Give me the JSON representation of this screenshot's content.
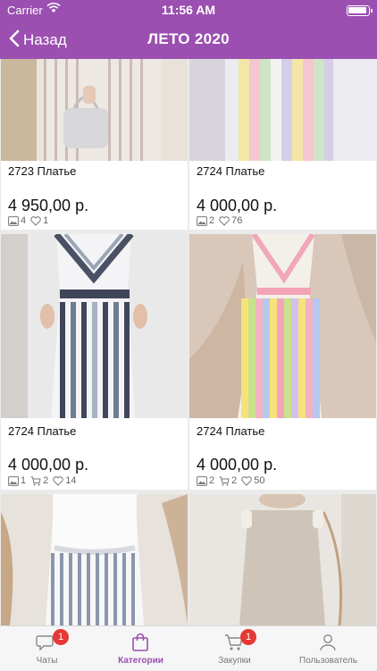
{
  "status": {
    "carrier": "Carrier",
    "time": "11:56 AM"
  },
  "nav": {
    "back_label": "Назад",
    "title": "ЛЕТО 2020"
  },
  "products": [
    {
      "name": "2723 Платье",
      "price": "4 950,00 р.",
      "photos": "4",
      "cart": "",
      "likes": "1"
    },
    {
      "name": "2724  Платье",
      "price": "4 000,00 р.",
      "photos": "2",
      "cart": "",
      "likes": "76"
    },
    {
      "name": "2724 Платье",
      "price": "4 000,00 р.",
      "photos": "1",
      "cart": "2",
      "likes": "14"
    },
    {
      "name": "2724 Платье",
      "price": "4 000,00 р.",
      "photos": "2",
      "cart": "2",
      "likes": "50"
    }
  ],
  "tabs": [
    {
      "label": "Чаты",
      "badge": "1"
    },
    {
      "label": "Категории",
      "badge": ""
    },
    {
      "label": "Закупки",
      "badge": "1"
    },
    {
      "label": "Пользователь",
      "badge": ""
    }
  ],
  "colors": {
    "accent": "#9b4fb0",
    "badge": "#e53935"
  }
}
